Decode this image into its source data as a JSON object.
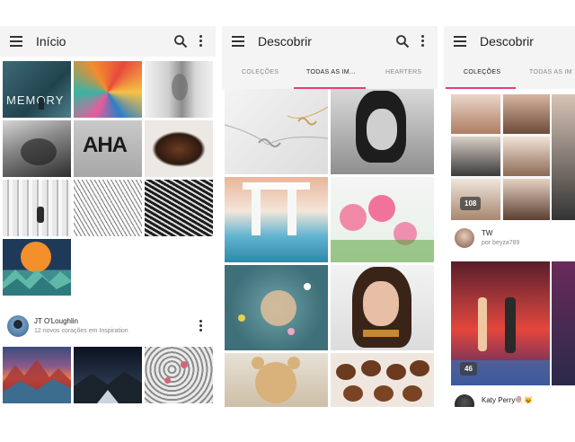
{
  "screens": [
    {
      "title": "Início",
      "icons": [
        "menu-icon",
        "search-icon",
        "more-vert-icon"
      ],
      "tiles": [
        "MEMORY",
        "AHA"
      ],
      "user": {
        "name": "JT O'Loughlin",
        "subtitle": "12 novos corações em Inspiration"
      }
    },
    {
      "title": "Descobrir",
      "icons": [
        "menu-icon",
        "search-icon",
        "more-vert-icon"
      ],
      "tabs": [
        "COLEÇÕES",
        "TODAS AS IM...",
        "HEARTERS"
      ],
      "active_tab": 1
    },
    {
      "title": "Descobrir",
      "icons": [
        "menu-icon"
      ],
      "tabs": [
        "COLEÇÕES",
        "TODAS AS IM"
      ],
      "active_tab": 0,
      "collections": [
        {
          "count": "108",
          "name": "TW",
          "owner": "por beyza789"
        },
        {
          "count": "46",
          "name": "Katy Perry🍭😺"
        }
      ]
    }
  ],
  "colors": {
    "accent": "#e0407b",
    "appbar": "#f4f4f4"
  }
}
